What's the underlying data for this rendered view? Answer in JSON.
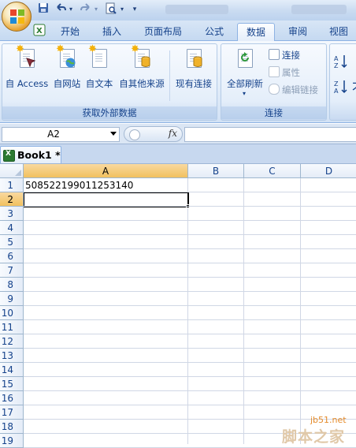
{
  "quick_access": {
    "save_icon": "save-icon",
    "undo_icon": "undo-icon",
    "redo_icon": "redo-icon",
    "preview_icon": "print-preview-icon",
    "customize_icon": "chevron-down-icon"
  },
  "tabs": [
    {
      "label": "开始"
    },
    {
      "label": "插入"
    },
    {
      "label": "页面布局"
    },
    {
      "label": "公式"
    },
    {
      "label": "数据"
    },
    {
      "label": "审阅"
    },
    {
      "label": "视图"
    }
  ],
  "active_tab": "数据",
  "ribbon": {
    "get_external": {
      "group_label": "获取外部数据",
      "access": "自 Access",
      "web": "自网站",
      "text": "自文本",
      "other": "自其他来源",
      "existing": "现有连接"
    },
    "connections": {
      "group_label": "连接",
      "refresh_all": "全部刷新",
      "connections": "连接",
      "properties": "属性",
      "edit_links": "编辑链接"
    },
    "sort": {
      "az": "A↓Z",
      "za": "Z↓A"
    }
  },
  "formula_bar": {
    "name_box": "A2",
    "fx": "fx",
    "formula": ""
  },
  "workbook": {
    "tab_label": "Book1 *"
  },
  "sheet": {
    "columns": [
      "A",
      "B",
      "C",
      "D"
    ],
    "rows": [
      "1",
      "2",
      "3",
      "4",
      "5",
      "6",
      "7",
      "8",
      "9",
      "10",
      "11",
      "12",
      "13",
      "14",
      "15",
      "16",
      "17",
      "18",
      "19"
    ],
    "selected_column": "A",
    "selected_row": "2",
    "cells": {
      "A1": "508522199011253140"
    }
  },
  "watermark": {
    "url": "jb51.net",
    "name": "脚本之家"
  },
  "colors": {
    "ribbon_bg": "#dbe6f4",
    "tab_text": "#15428b",
    "selected_header": "#f1c15f",
    "gridline": "#d0d7e5"
  }
}
